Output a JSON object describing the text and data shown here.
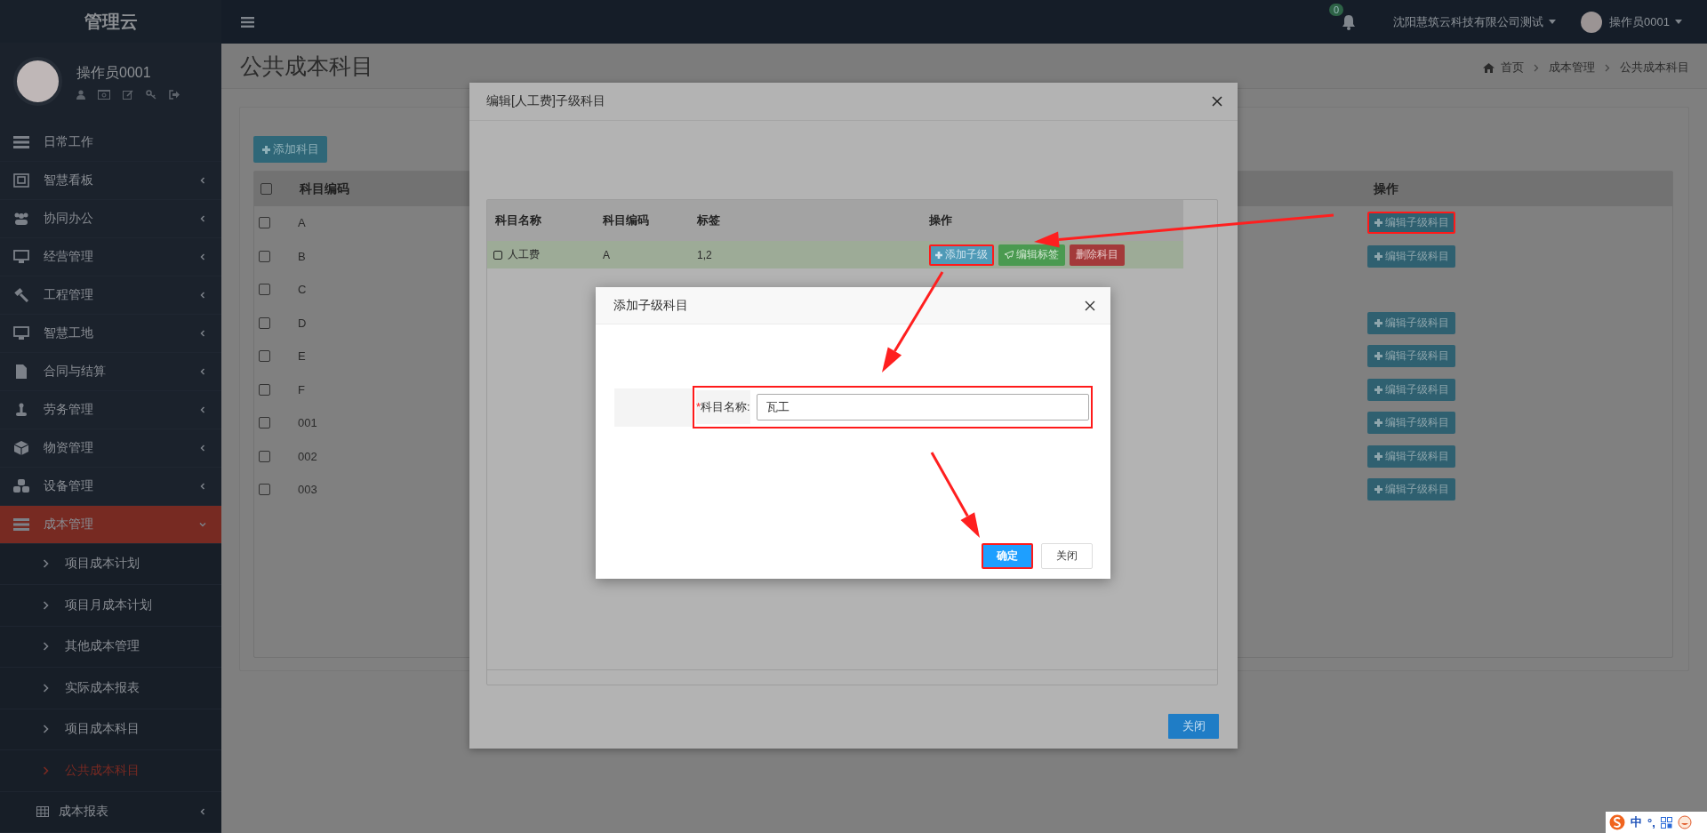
{
  "brand": "管理云",
  "profile": {
    "name": "操作员0001"
  },
  "sidebar": {
    "items": [
      {
        "label": "日常工作",
        "kind": "link",
        "selected": false
      },
      {
        "label": "智慧看板",
        "kind": "group",
        "selected": false,
        "expanded": false
      },
      {
        "label": "协同办公",
        "kind": "group",
        "selected": false,
        "expanded": false
      },
      {
        "label": "经营管理",
        "kind": "group",
        "selected": false,
        "expanded": false
      },
      {
        "label": "工程管理",
        "kind": "group",
        "selected": false,
        "expanded": false
      },
      {
        "label": "智慧工地",
        "kind": "group",
        "selected": false,
        "expanded": false
      },
      {
        "label": "合同与结算",
        "kind": "group",
        "selected": false,
        "expanded": false
      },
      {
        "label": "劳务管理",
        "kind": "group",
        "selected": false,
        "expanded": false
      },
      {
        "label": "物资管理",
        "kind": "group",
        "selected": false,
        "expanded": false
      },
      {
        "label": "设备管理",
        "kind": "group",
        "selected": false,
        "expanded": false
      },
      {
        "label": "成本管理",
        "kind": "group",
        "selected": true,
        "expanded": true,
        "children": [
          {
            "label": "项目成本计划",
            "kind": "link",
            "selected": false
          },
          {
            "label": "项目月成本计划",
            "kind": "link",
            "selected": false
          },
          {
            "label": "其他成本管理",
            "kind": "link",
            "selected": false
          },
          {
            "label": "实际成本报表",
            "kind": "link",
            "selected": false
          },
          {
            "label": "项目成本科目",
            "kind": "link",
            "selected": false
          },
          {
            "label": "公共成本科目",
            "kind": "link",
            "selected": true
          },
          {
            "label": "成本报表",
            "kind": "group",
            "selected": false,
            "expanded": false
          }
        ]
      }
    ]
  },
  "topbar": {
    "notifications": "0",
    "company": "沈阳慧筑云科技有限公司测试",
    "user": "操作员0001"
  },
  "page": {
    "title": "公共成本科目",
    "breadcrumb": [
      "首页",
      "成本管理",
      "公共成本科目"
    ]
  },
  "main": {
    "add_button": "添加科目",
    "select_all": {
      "checked": false
    },
    "columns": [
      "科目编码",
      "操作"
    ],
    "rows": [
      {
        "code": "A",
        "checked": false,
        "action": "编辑子级科目",
        "highlighted": true
      },
      {
        "code": "B",
        "checked": false,
        "action": "编辑子级科目",
        "highlighted": false
      },
      {
        "code": "C",
        "checked": false
      },
      {
        "code": "D",
        "checked": false,
        "action": "编辑子级科目",
        "highlighted": false
      },
      {
        "code": "E",
        "checked": false,
        "action": "编辑子级科目",
        "highlighted": false
      },
      {
        "code": "F",
        "checked": false,
        "action": "编辑子级科目",
        "highlighted": false
      },
      {
        "code": "001",
        "checked": false,
        "action": "编辑子级科目",
        "highlighted": false
      },
      {
        "code": "002",
        "checked": false,
        "action": "编辑子级科目",
        "highlighted": false
      },
      {
        "code": "003",
        "checked": false,
        "action": "编辑子级科目",
        "highlighted": false
      }
    ]
  },
  "outer_modal": {
    "title": "编辑[人工费]子级科目",
    "columns": [
      "科目名称",
      "科目编码",
      "标签",
      "操作"
    ],
    "rows": [
      {
        "name": "人工费",
        "code": "A",
        "tags": "1,2",
        "selected": true,
        "actions": [
          {
            "label": "添加子级",
            "kind": "add",
            "highlighted": true
          },
          {
            "label": "编辑标签",
            "kind": "tag",
            "highlighted": false
          },
          {
            "label": "删除科目",
            "kind": "delete",
            "highlighted": false
          }
        ]
      }
    ],
    "close_button": "关闭"
  },
  "inner_modal": {
    "title": "添加子级科目",
    "field": {
      "required_mark": "*",
      "label": "科目名称:",
      "value": "瓦工",
      "highlighted": true
    },
    "buttons": [
      {
        "label": "确定",
        "kind": "primary",
        "highlighted": true
      },
      {
        "label": "关闭",
        "kind": "default",
        "highlighted": false
      }
    ]
  },
  "ime_bar": {
    "items": [
      "中",
      "°,"
    ]
  }
}
